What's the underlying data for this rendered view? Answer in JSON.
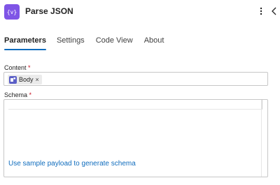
{
  "header": {
    "title": "Parse JSON",
    "icon": "parse-json-icon",
    "accent_color": "#7f55e6"
  },
  "tabs": [
    {
      "label": "Parameters",
      "active": true
    },
    {
      "label": "Settings",
      "active": false
    },
    {
      "label": "Code View",
      "active": false
    },
    {
      "label": "About",
      "active": false
    }
  ],
  "content_field": {
    "label": "Content",
    "required_mark": "*",
    "token": {
      "label": "Body",
      "remove": "×",
      "icon": "dynamic-content-icon"
    }
  },
  "schema_field": {
    "label": "Schema",
    "required_mark": "*",
    "link_text": "Use sample payload to generate schema"
  }
}
